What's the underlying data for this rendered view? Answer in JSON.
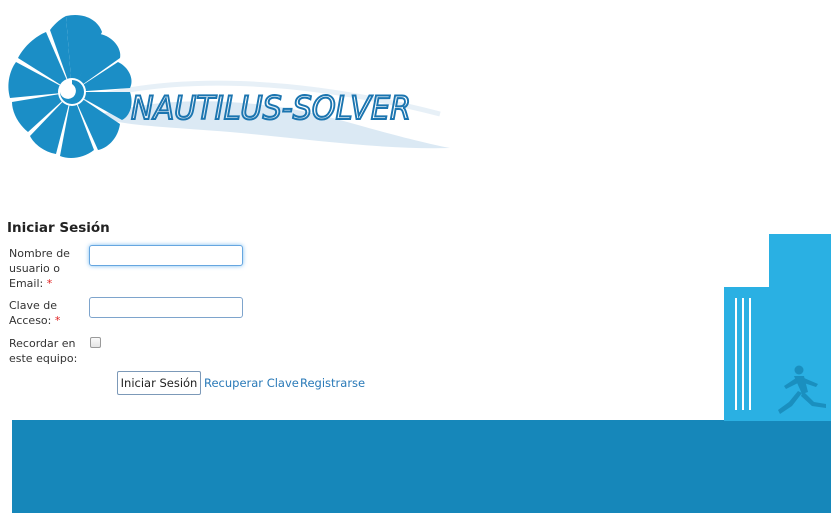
{
  "brand": {
    "name": "NAUTILUS-SOLVER"
  },
  "login": {
    "title": "Iniciar Sesión",
    "username_label": "Nombre de usuario o Email:",
    "password_label": "Clave de Acceso:",
    "remember_label": "Recordar en este equipo:",
    "required_marker": "*",
    "username_value": "",
    "password_value": "",
    "remember_checked": false,
    "submit_label": "Iniciar Sesión",
    "recover_link": "Recuperar Clave",
    "register_link": "Registrarse"
  },
  "colors": {
    "brand_blue": "#1b8ec6",
    "floor_blue": "#1687ba",
    "tower_blue": "#2ab0e3",
    "link_blue": "#2a7ab8",
    "required_red": "#e02020"
  }
}
